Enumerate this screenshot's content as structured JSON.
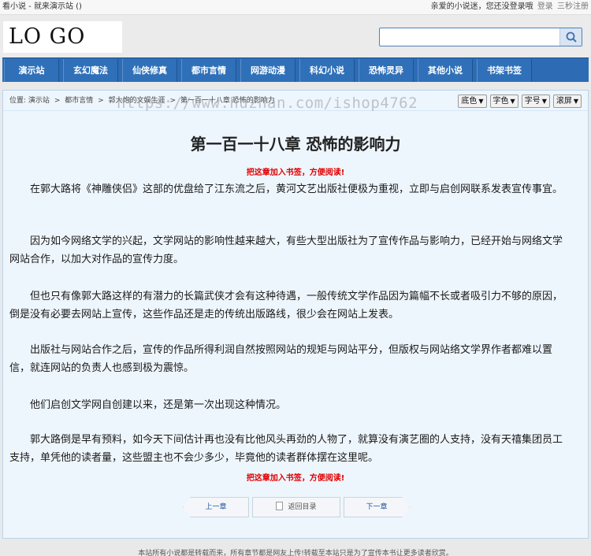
{
  "topbar": {
    "left_text": "看小说 - 就来演示站 ()",
    "greeting": "亲爱的小说迷，您还没登录哦",
    "login_link": "登录",
    "register_link": "三秒注册"
  },
  "header": {
    "logo_text": "LO GO",
    "search_value": "",
    "search_placeholder": ""
  },
  "nav": {
    "items": [
      "演示站",
      "玄幻魔法",
      "仙侠修真",
      "都市言情",
      "网游动漫",
      "科幻小说",
      "恐怖灵异",
      "其他小说",
      "书架书签"
    ]
  },
  "breadcrumb": {
    "prefix": "位置:",
    "items": [
      "演示站",
      "都市言情",
      "郭大炮的文娱生涯",
      "第一百一十八章 恐怖的影响力"
    ],
    "separator": ">"
  },
  "tools": {
    "bg_color": "底色",
    "font_color": "字色",
    "font_size": "字号",
    "scroll": "滚屏"
  },
  "watermark": "https://www.huzhan.com/ishop4762",
  "chapter": {
    "title": "第一百一十八章 恐怖的影响力",
    "bookmark_tip": "把这章加入书签，方便阅读!",
    "paragraphs": [
      "在郭大路将《神雕侠侣》这部的优盘给了江东流之后，黄河文艺出版社便极为重视，立即与启创网联系发表宣传事宜。",
      "因为如今网络文学的兴起，文学网站的影响性越来越大，有些大型出版社为了宣传作品与影响力，已经开始与网络文学网站合作，以加大对作品的宣传力度。",
      "但也只有像郭大路这样的有潜力的长篇武侠才会有这种待遇，一般传统文学作品因为篇幅不长或者吸引力不够的原因，倒是没有必要去网站上宣传，这些作品还是走的传统出版路线，很少会在网站上发表。",
      "出版社与网站合作之后，宣传的作品所得利润自然按照网站的规矩与网站平分，但版权与网站络文学界作者都难以置信，就连网站的负责人也感到极为震惊。",
      "他们启创文学网自创建以来，还是第一次出现这种情况。",
      "郭大路倒是早有预料，如今天下间估计再也没有比他风头再劲的人物了，就算没有演艺圈的人支持，没有天禧集团员工支持，单凭他的读者量，这些盟主也不会少多少，毕竟他的读者群体摆在这里呢。"
    ]
  },
  "pager": {
    "prev": "上一章",
    "menu": "返回目录",
    "next": "下一章"
  },
  "footer": {
    "text": "本站所有小说都是转载而来，所有章节都是网友上传!转载至本站只是为了宣传本书让更多读者欣赏。"
  },
  "colors": {
    "nav_bg": "#2d6cb4",
    "content_bg": "#eef6fd",
    "bookmark_red": "#e00000",
    "link_blue": "#1f55a0"
  }
}
